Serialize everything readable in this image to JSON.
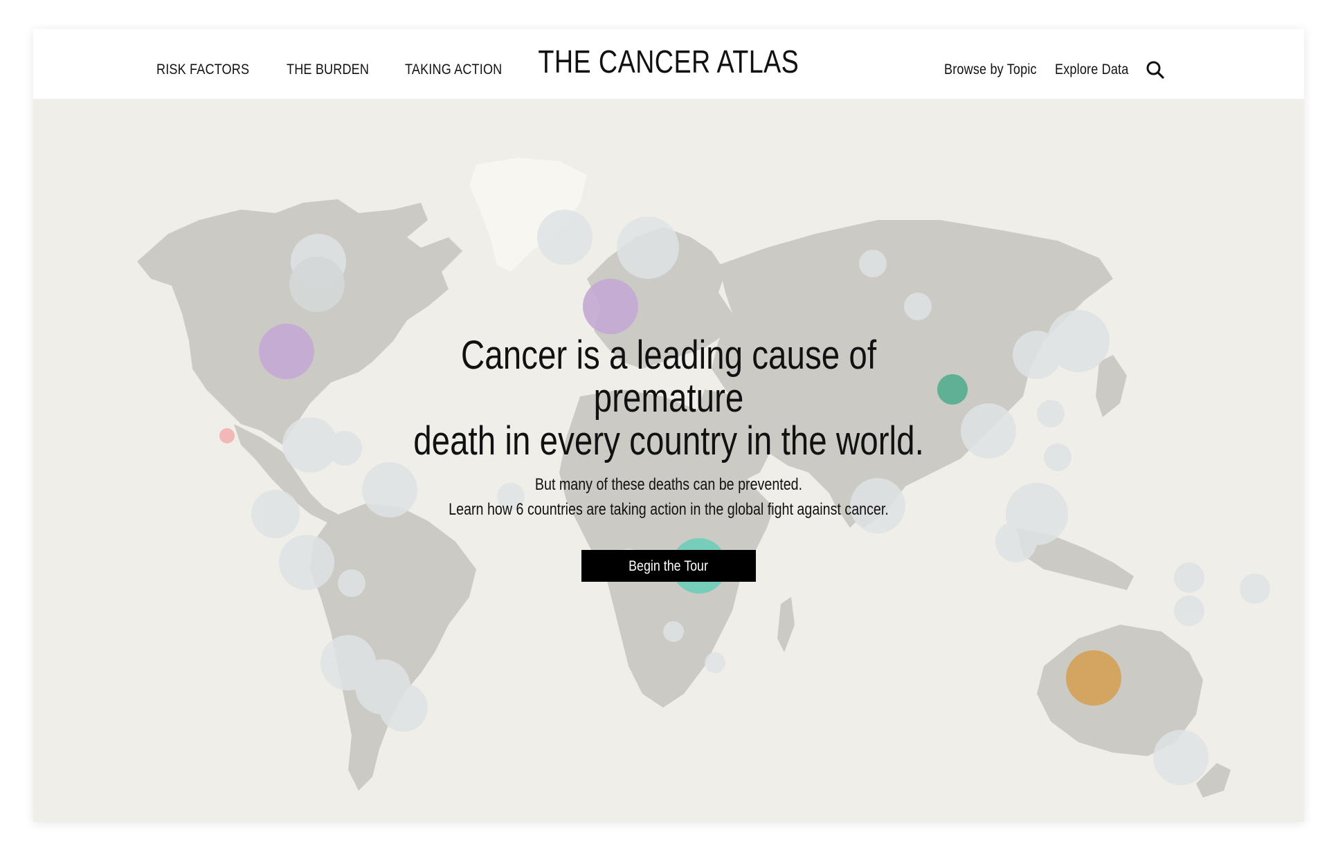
{
  "header": {
    "nav_left": [
      "RISK FACTORS",
      "THE BURDEN",
      "TAKING ACTION"
    ],
    "logo": "THE CANCER ATLAS",
    "nav_right": [
      "Browse by Topic",
      "Explore Data"
    ],
    "search_icon": "search-icon"
  },
  "hero": {
    "headline_line1": "Cancer is a leading cause of premature",
    "headline_line2": "death in every country in the world.",
    "sub_line1": "But many of these deaths can be prevented.",
    "sub_line2": "Learn how 6 countries are taking action in the global fight against cancer.",
    "cta_label": "Begin the Tour"
  },
  "colors": {
    "map_background": "#efeee8",
    "land": "#cbcac5",
    "neutral_bubble": "#dfe3e4",
    "purple_bubble": "#c3a8d3",
    "teal_bubble": "#6dcdb8",
    "dark_teal_bubble": "#5aae93",
    "orange_bubble": "#d4a25c",
    "pink_bubble": "#f2b3b5",
    "button_bg": "#000000",
    "button_text": "#ffffff"
  }
}
